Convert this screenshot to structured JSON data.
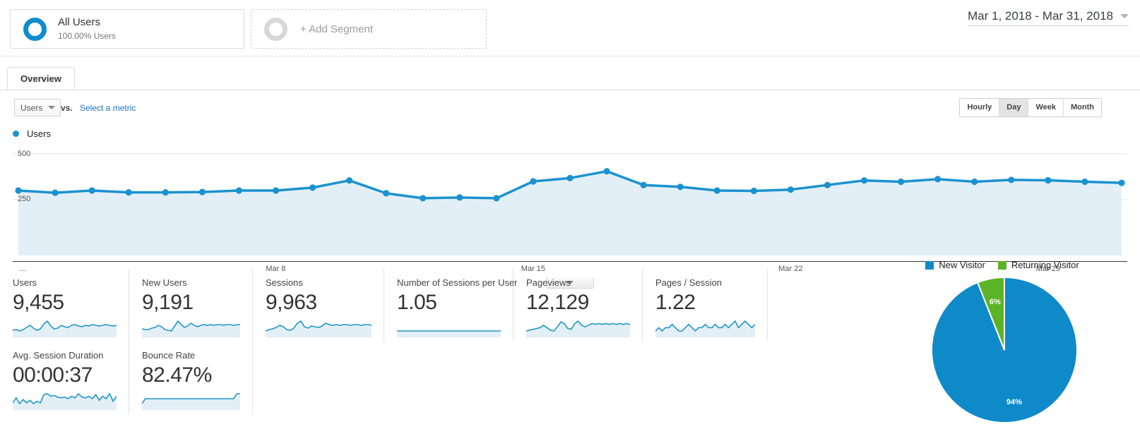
{
  "segments": {
    "all_users": {
      "title": "All Users",
      "subtitle": "100.00% Users",
      "icon": "donut-icon"
    },
    "add_segment": {
      "label": "+ Add Segment",
      "icon": "donut-icon"
    }
  },
  "date_range": {
    "label": "Mar 1, 2018 - Mar 31, 2018",
    "caret_icon": "chevron-down-icon"
  },
  "tabs": [
    {
      "label": "Overview",
      "active": true
    }
  ],
  "metric_controls": {
    "primary_metric": "Users",
    "vs_label": "vs.",
    "secondary_metric_link": "Select a metric",
    "granularity": [
      {
        "label": "Hourly",
        "active": false
      },
      {
        "label": "Day",
        "active": true
      },
      {
        "label": "Week",
        "active": false
      },
      {
        "label": "Month",
        "active": false
      }
    ]
  },
  "chart_data": {
    "type": "line",
    "title": "Users",
    "legend": [
      "Users"
    ],
    "legend_position": "top-left",
    "xlabel": "",
    "ylabel": "",
    "ylim": [
      0,
      500
    ],
    "yticks": [
      250,
      500
    ],
    "grid": true,
    "area_fill": true,
    "line_color": "#1b92d0",
    "fill_color": "#e3eff7",
    "x_tick_labels": [
      "...",
      "Mar 8",
      "Mar 15",
      "Mar 22",
      "Mar 29"
    ],
    "x_tick_positions": [
      1,
      8,
      15,
      22,
      29
    ],
    "x": [
      "Mar 1",
      "Mar 2",
      "Mar 3",
      "Mar 4",
      "Mar 5",
      "Mar 6",
      "Mar 7",
      "Mar 8",
      "Mar 9",
      "Mar 10",
      "Mar 11",
      "Mar 12",
      "Mar 13",
      "Mar 14",
      "Mar 15",
      "Mar 16",
      "Mar 17",
      "Mar 18",
      "Mar 19",
      "Mar 20",
      "Mar 21",
      "Mar 22",
      "Mar 23",
      "Mar 24",
      "Mar 25",
      "Mar 26",
      "Mar 27",
      "Mar 28",
      "Mar 29",
      "Mar 30",
      "Mar 31"
    ],
    "values": [
      300,
      288,
      300,
      290,
      290,
      292,
      300,
      300,
      316,
      355,
      285,
      258,
      262,
      258,
      350,
      368,
      405,
      330,
      320,
      300,
      298,
      305,
      330,
      355,
      348,
      362,
      348,
      358,
      356,
      348,
      342
    ]
  },
  "metric_cards": [
    {
      "label": "Users",
      "value": "9,455",
      "spark": [
        5,
        6,
        4,
        6,
        9,
        12,
        8,
        5,
        7,
        14,
        18,
        11,
        7,
        8,
        12,
        10,
        9,
        12,
        13,
        11,
        10,
        12,
        11,
        13,
        12,
        11,
        12,
        13,
        12,
        11,
        12
      ]
    },
    {
      "label": "New Users",
      "value": "9,191",
      "spark": [
        6,
        5,
        5,
        7,
        8,
        11,
        9,
        5,
        4,
        3,
        10,
        17,
        12,
        8,
        10,
        14,
        11,
        9,
        11,
        12,
        11,
        12,
        11,
        12,
        12,
        11,
        12,
        12,
        11,
        12,
        12
      ]
    },
    {
      "label": "Sessions",
      "value": "9,963",
      "spark": [
        4,
        6,
        7,
        9,
        12,
        10,
        6,
        5,
        8,
        15,
        18,
        10,
        8,
        11,
        10,
        9,
        11,
        15,
        13,
        12,
        13,
        12,
        13,
        13,
        12,
        13,
        13,
        12,
        13,
        13,
        12
      ]
    },
    {
      "label": "Number of Sessions per User",
      "value": "1.05",
      "spark": [
        10,
        10,
        10,
        10,
        10,
        10,
        10,
        10,
        10,
        10,
        10,
        10,
        10,
        10,
        10,
        10,
        10,
        10,
        10,
        10,
        10,
        10,
        10,
        10,
        10,
        10,
        10,
        10,
        10,
        10,
        10
      ]
    },
    {
      "label": "Pageviews",
      "value": "12,129",
      "spark": [
        5,
        6,
        7,
        8,
        9,
        12,
        9,
        6,
        5,
        10,
        16,
        14,
        8,
        7,
        14,
        17,
        12,
        10,
        12,
        14,
        13,
        14,
        13,
        14,
        13,
        14,
        13,
        14,
        13,
        14,
        13
      ]
    },
    {
      "label": "Pages / Session",
      "value": "1.22",
      "spark": [
        10,
        11,
        10,
        11,
        11,
        12,
        11,
        10,
        10,
        11,
        12,
        11,
        10,
        11,
        11,
        12,
        11,
        11,
        12,
        11,
        11,
        12,
        11,
        12,
        13,
        11,
        12,
        13,
        12,
        11,
        12
      ]
    },
    {
      "label": "Avg. Session Duration",
      "value": "00:00:37",
      "spark": [
        6,
        12,
        5,
        10,
        6,
        9,
        5,
        8,
        6,
        16,
        17,
        14,
        15,
        13,
        12,
        13,
        11,
        14,
        12,
        17,
        13,
        12,
        14,
        11,
        16,
        9,
        14,
        11,
        17,
        8,
        14
      ]
    },
    {
      "label": "Bounce Rate",
      "value": "82.47%",
      "spark": [
        12,
        13,
        13,
        13,
        13,
        13,
        13,
        13,
        13,
        13,
        13,
        13,
        13,
        13,
        13,
        13,
        13,
        13,
        13,
        13,
        13,
        13,
        13,
        13,
        13,
        13,
        13,
        13,
        13,
        14,
        14
      ]
    }
  ],
  "pie_chart": {
    "type": "pie",
    "title": "",
    "legend_position": "top",
    "labels": [
      "New Visitor",
      "Returning Visitor"
    ],
    "values": [
      94,
      6
    ],
    "value_labels": [
      "94%",
      "6%"
    ],
    "colors": [
      "#0e8ac8",
      "#5cb327"
    ]
  },
  "expand_handle": {
    "icon": "chevron-down-icon"
  }
}
